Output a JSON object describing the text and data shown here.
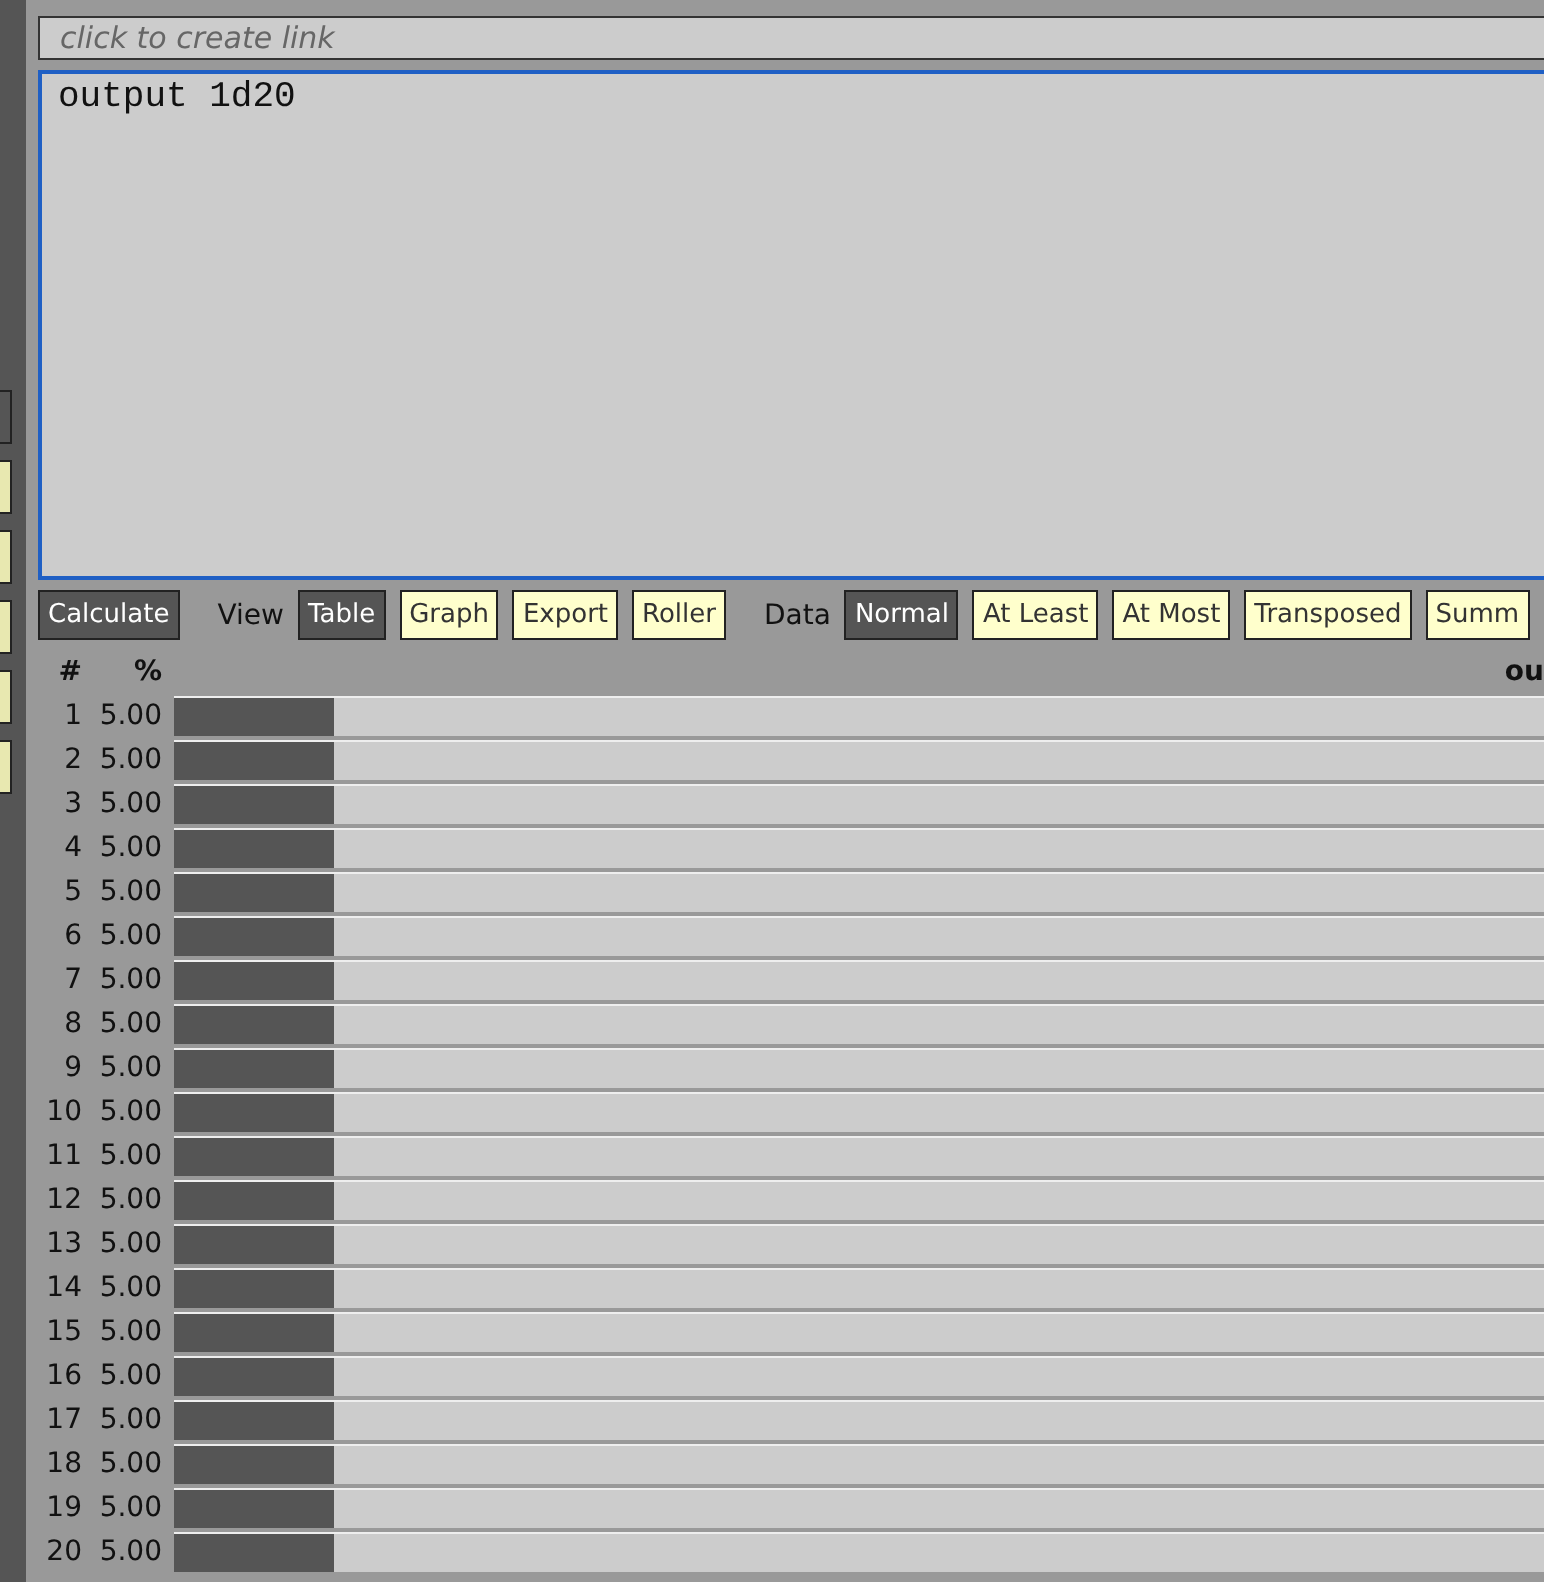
{
  "side_buttons": [
    {
      "selected": true
    },
    {
      "selected": false
    },
    {
      "selected": false
    },
    {
      "selected": false
    },
    {
      "selected": false
    },
    {
      "selected": false
    }
  ],
  "link_field": {
    "placeholder": "click to create link"
  },
  "editor": {
    "value": "output 1d20"
  },
  "calculate_button": "Calculate",
  "view": {
    "label": "View",
    "options": [
      {
        "label": "Table",
        "selected": true
      },
      {
        "label": "Graph",
        "selected": false
      },
      {
        "label": "Export",
        "selected": false
      },
      {
        "label": "Roller",
        "selected": false
      }
    ]
  },
  "data": {
    "label": "Data",
    "options": [
      {
        "label": "Normal",
        "selected": true
      },
      {
        "label": "At Least",
        "selected": false
      },
      {
        "label": "At Most",
        "selected": false
      },
      {
        "label": "Transposed",
        "selected": false
      },
      {
        "label": "Summ",
        "selected": false
      }
    ]
  },
  "table": {
    "columns": [
      "#",
      "%",
      "ou"
    ],
    "rows": [
      {
        "n": "1",
        "pct": "5.00",
        "level": 0.05
      },
      {
        "n": "2",
        "pct": "5.00",
        "level": 0.05
      },
      {
        "n": "3",
        "pct": "5.00",
        "level": 0.05
      },
      {
        "n": "4",
        "pct": "5.00",
        "level": 0.05
      },
      {
        "n": "5",
        "pct": "5.00",
        "level": 0.05
      },
      {
        "n": "6",
        "pct": "5.00",
        "level": 0.05
      },
      {
        "n": "7",
        "pct": "5.00",
        "level": 0.05
      },
      {
        "n": "8",
        "pct": "5.00",
        "level": 0.05
      },
      {
        "n": "9",
        "pct": "5.00",
        "level": 0.05
      },
      {
        "n": "10",
        "pct": "5.00",
        "level": 0.05
      },
      {
        "n": "11",
        "pct": "5.00",
        "level": 0.05
      },
      {
        "n": "12",
        "pct": "5.00",
        "level": 0.05
      },
      {
        "n": "13",
        "pct": "5.00",
        "level": 0.05
      },
      {
        "n": "14",
        "pct": "5.00",
        "level": 0.05
      },
      {
        "n": "15",
        "pct": "5.00",
        "level": 0.05
      },
      {
        "n": "16",
        "pct": "5.00",
        "level": 0.05
      },
      {
        "n": "17",
        "pct": "5.00",
        "level": 0.05
      },
      {
        "n": "18",
        "pct": "5.00",
        "level": 0.05
      },
      {
        "n": "19",
        "pct": "5.00",
        "level": 0.05
      },
      {
        "n": "20",
        "pct": "5.00",
        "level": 0.05
      }
    ]
  }
}
